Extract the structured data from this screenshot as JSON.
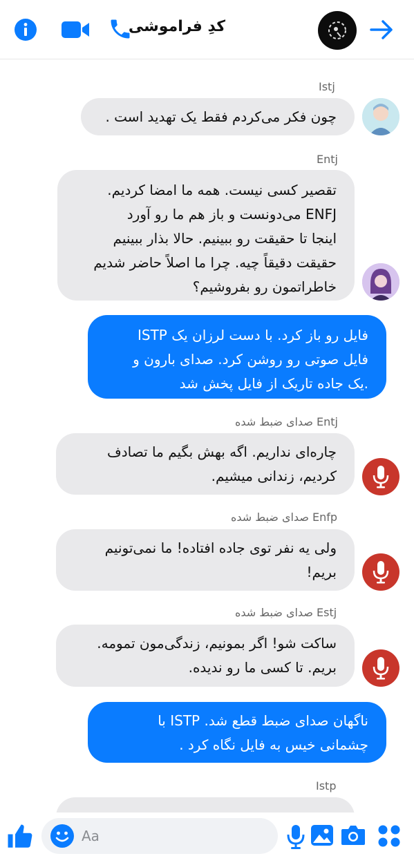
{
  "header": {
    "title": "کدِ فراموشی",
    "icons": [
      "info-icon",
      "video-call-icon",
      "phone-icon",
      "back-arrow-icon"
    ],
    "accent": "#0a7cff"
  },
  "messages": [
    {
      "sender": "Istj",
      "text": "چون فکر می‌کردم فقط یک تهدید است ."
    },
    {
      "sender": "Entj",
      "text": "تقصیر کسی نیست. همه ما امضا کردیم.\nENFJ می‌دونست و باز هم ما رو آورد\nاینجا تا حقیقت رو ببینیم. حالا بذار ببینیم\nحقیقت دقیقاً چیه. چرا ما اصلاً حاضر شدیم\nخاطراتمون رو بفروشیم؟"
    },
    {
      "text": "فایل رو باز کرد. با دست لرزان یک ISTP\nفایل صوتی رو روشن کرد. صدای بارون و\n.یک جاده تاریک از فایل پخش شد"
    },
    {
      "sender": "صدای ضبط شده Entj",
      "text": "چاره‌ای نداریم. اگه بهش بگیم ما تصادف\nکردیم، زندانی میشیم."
    },
    {
      "sender": "صدای ضبط شده Enfp",
      "text": "ولی یه نفر توی جاده افتاده! ما نمی‌تونیم\nبریم!"
    },
    {
      "sender": "صدای ضبط شده Estj",
      "text": "ساکت شو! اگر بمونیم، زندگی‌مون تمومه.\nبریم. تا کسی ما رو ندیده."
    },
    {
      "text": "ناگهان صدای ضبط قطع شد. ISTP با\nچشمانی خیس به فایل نگاه کرد ."
    },
    {
      "sender": "Istp",
      "text": ""
    }
  ],
  "composer": {
    "placeholder": "Aa",
    "icons": [
      "like-icon",
      "emoji-icon",
      "microphone-icon",
      "gallery-icon",
      "camera-icon",
      "menu-grid-icon"
    ]
  },
  "colors": {
    "bubble_in": "#e9e9eb",
    "bubble_out": "#0a7cff",
    "mic_avatar": "#c8362b"
  }
}
